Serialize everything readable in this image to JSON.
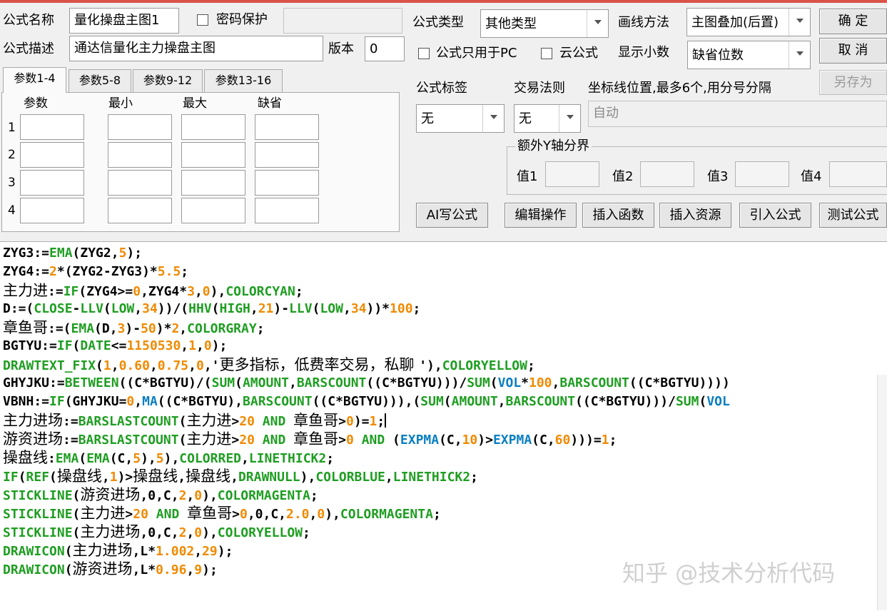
{
  "form": {
    "name_label": "公式名称",
    "name_value": "量化操盘主图1",
    "password_label": "密码保护",
    "desc_label": "公式描述",
    "desc_value": "通达信量化主力操盘主图",
    "version_label": "版本",
    "version_value": "0",
    "type_label": "公式类型",
    "type_value": "其他类型",
    "draw_label": "画线方法",
    "draw_value": "主图叠加(后置)",
    "pc_only_label": "公式只用于PC",
    "cloud_label": "云公式",
    "decimals_label": "显示小数",
    "decimals_value": "缺省位数",
    "tag_label": "公式标签",
    "tag_value": "无",
    "trade_label": "交易法则",
    "trade_value": "无",
    "axis_label": "坐标线位置,最多6个,用分号分隔",
    "axis_value": "自动",
    "extra_y_label": "额外Y轴分界",
    "y_values": [
      "值1",
      "值2",
      "值3",
      "值4"
    ]
  },
  "buttons": {
    "ok": "确  定",
    "cancel": "取  消",
    "save_as": "另存为",
    "ai": "AI写公式",
    "edit": "编辑操作",
    "insert_func": "插入函数",
    "insert_res": "插入资源",
    "import": "引入公式",
    "test": "测试公式"
  },
  "tabs": [
    "参数1-4",
    "参数5-8",
    "参数9-12",
    "参数13-16"
  ],
  "params": {
    "headers": [
      "参数",
      "最小",
      "最大",
      "缺省"
    ],
    "rows": [
      "1",
      "2",
      "3",
      "4"
    ]
  },
  "colors": {
    "keyword_green": "#1f9e22",
    "function_blue": "#0a7fc2",
    "number_orange": "#f08a00",
    "text_black": "#000000",
    "title_red": "#d9534a"
  },
  "code": [
    [
      {
        "t": "ZYG3:=",
        "c": "k"
      },
      {
        "t": "EMA",
        "c": "g"
      },
      {
        "t": "(ZYG2,",
        "c": "k"
      },
      {
        "t": "5",
        "c": "o"
      },
      {
        "t": ");",
        "c": "k"
      }
    ],
    [
      {
        "t": "ZYG4:=",
        "c": "k"
      },
      {
        "t": "2",
        "c": "o"
      },
      {
        "t": "*(ZYG2-ZYG3)*",
        "c": "k"
      },
      {
        "t": "5.5",
        "c": "o"
      },
      {
        "t": ";",
        "c": "k"
      }
    ],
    [
      {
        "t": "主力进",
        "c": "kc"
      },
      {
        "t": ":=",
        "c": "k"
      },
      {
        "t": "IF",
        "c": "g"
      },
      {
        "t": "(ZYG4>=",
        "c": "k"
      },
      {
        "t": "0",
        "c": "o"
      },
      {
        "t": ",ZYG4*",
        "c": "k"
      },
      {
        "t": "3",
        "c": "o"
      },
      {
        "t": ",",
        "c": "k"
      },
      {
        "t": "0",
        "c": "o"
      },
      {
        "t": "),",
        "c": "k"
      },
      {
        "t": "COLORCYAN",
        "c": "g"
      },
      {
        "t": ";",
        "c": "k"
      }
    ],
    [
      {
        "t": "D:=(",
        "c": "k"
      },
      {
        "t": "CLOSE",
        "c": "g"
      },
      {
        "t": "-",
        "c": "k"
      },
      {
        "t": "LLV",
        "c": "g"
      },
      {
        "t": "(",
        "c": "k"
      },
      {
        "t": "LOW",
        "c": "g"
      },
      {
        "t": ",",
        "c": "k"
      },
      {
        "t": "34",
        "c": "o"
      },
      {
        "t": "))/(",
        "c": "k"
      },
      {
        "t": "HHV",
        "c": "g"
      },
      {
        "t": "(",
        "c": "k"
      },
      {
        "t": "HIGH",
        "c": "g"
      },
      {
        "t": ",",
        "c": "k"
      },
      {
        "t": "21",
        "c": "o"
      },
      {
        "t": ")-",
        "c": "k"
      },
      {
        "t": "LLV",
        "c": "g"
      },
      {
        "t": "(",
        "c": "k"
      },
      {
        "t": "LOW",
        "c": "g"
      },
      {
        "t": ",",
        "c": "k"
      },
      {
        "t": "34",
        "c": "o"
      },
      {
        "t": "))*",
        "c": "k"
      },
      {
        "t": "100",
        "c": "o"
      },
      {
        "t": ";",
        "c": "k"
      }
    ],
    [
      {
        "t": "章鱼哥",
        "c": "kc"
      },
      {
        "t": ":=(",
        "c": "k"
      },
      {
        "t": "EMA",
        "c": "g"
      },
      {
        "t": "(D,",
        "c": "k"
      },
      {
        "t": "3",
        "c": "o"
      },
      {
        "t": ")-",
        "c": "k"
      },
      {
        "t": "50",
        "c": "o"
      },
      {
        "t": ")*",
        "c": "k"
      },
      {
        "t": "2",
        "c": "o"
      },
      {
        "t": ",",
        "c": "k"
      },
      {
        "t": "COLORGRAY",
        "c": "g"
      },
      {
        "t": ";",
        "c": "k"
      }
    ],
    [
      {
        "t": "BGTYU:=",
        "c": "k"
      },
      {
        "t": "IF",
        "c": "g"
      },
      {
        "t": "(",
        "c": "k"
      },
      {
        "t": "DATE",
        "c": "g"
      },
      {
        "t": "<=",
        "c": "k"
      },
      {
        "t": "1150530",
        "c": "o"
      },
      {
        "t": ",",
        "c": "k"
      },
      {
        "t": "1",
        "c": "o"
      },
      {
        "t": ",",
        "c": "k"
      },
      {
        "t": "0",
        "c": "o"
      },
      {
        "t": ");",
        "c": "k"
      }
    ],
    [
      {
        "t": "DRAWTEXT_FIX",
        "c": "g"
      },
      {
        "t": "(",
        "c": "k"
      },
      {
        "t": "1",
        "c": "o"
      },
      {
        "t": ",",
        "c": "k"
      },
      {
        "t": "0.60",
        "c": "o"
      },
      {
        "t": ",",
        "c": "k"
      },
      {
        "t": "0.75",
        "c": "o"
      },
      {
        "t": ",",
        "c": "k"
      },
      {
        "t": "0",
        "c": "o"
      },
      {
        "t": ",'",
        "c": "k"
      },
      {
        "t": "更多指标，低费率交易，私聊 ",
        "c": "kc"
      },
      {
        "t": "'),",
        "c": "k"
      },
      {
        "t": "COLORYELLOW",
        "c": "g"
      },
      {
        "t": ";",
        "c": "k"
      }
    ],
    [
      {
        "t": "GHYJKU:=",
        "c": "k"
      },
      {
        "t": "BETWEEN",
        "c": "g"
      },
      {
        "t": "((C*BGTYU)/(",
        "c": "k"
      },
      {
        "t": "SUM",
        "c": "g"
      },
      {
        "t": "(",
        "c": "k"
      },
      {
        "t": "AMOUNT",
        "c": "g"
      },
      {
        "t": ",",
        "c": "k"
      },
      {
        "t": "BARSCOUNT",
        "c": "g"
      },
      {
        "t": "((C*BGTYU)))/",
        "c": "k"
      },
      {
        "t": "SUM",
        "c": "g"
      },
      {
        "t": "(",
        "c": "k"
      },
      {
        "t": "VOL",
        "c": "b"
      },
      {
        "t": "*",
        "c": "k"
      },
      {
        "t": "100",
        "c": "o"
      },
      {
        "t": ",",
        "c": "k"
      },
      {
        "t": "BARSCOUNT",
        "c": "g"
      },
      {
        "t": "((C*BGTYU))))",
        "c": "k"
      }
    ],
    [
      {
        "t": "VBNH:=",
        "c": "k"
      },
      {
        "t": "IF",
        "c": "g"
      },
      {
        "t": "(GHYJKU=",
        "c": "k"
      },
      {
        "t": "0",
        "c": "o"
      },
      {
        "t": ",",
        "c": "k"
      },
      {
        "t": "MA",
        "c": "b"
      },
      {
        "t": "((C*BGTYU),",
        "c": "k"
      },
      {
        "t": "BARSCOUNT",
        "c": "g"
      },
      {
        "t": "((C*BGTYU))),(",
        "c": "k"
      },
      {
        "t": "SUM",
        "c": "g"
      },
      {
        "t": "(",
        "c": "k"
      },
      {
        "t": "AMOUNT",
        "c": "g"
      },
      {
        "t": ",",
        "c": "k"
      },
      {
        "t": "BARSCOUNT",
        "c": "g"
      },
      {
        "t": "((C*BGTYU)))/",
        "c": "k"
      },
      {
        "t": "SUM",
        "c": "g"
      },
      {
        "t": "(",
        "c": "k"
      },
      {
        "t": "VOL",
        "c": "b"
      }
    ],
    [
      {
        "t": "主力进场",
        "c": "kc"
      },
      {
        "t": ":=",
        "c": "k"
      },
      {
        "t": "BARSLASTCOUNT",
        "c": "g"
      },
      {
        "t": "(",
        "c": "k"
      },
      {
        "t": "主力进",
        "c": "kc"
      },
      {
        "t": ">",
        "c": "k"
      },
      {
        "t": "20",
        "c": "o"
      },
      {
        "t": " ",
        "c": "k"
      },
      {
        "t": "AND",
        "c": "g"
      },
      {
        "t": " ",
        "c": "k"
      },
      {
        "t": "章鱼哥",
        "c": "kc"
      },
      {
        "t": ">",
        "c": "k"
      },
      {
        "t": "0",
        "c": "o"
      },
      {
        "t": ")=",
        "c": "k"
      },
      {
        "t": "1",
        "c": "o"
      },
      {
        "t": ";",
        "c": "k"
      },
      {
        "t": "",
        "c": "caret"
      }
    ],
    [
      {
        "t": "游资进场",
        "c": "kc"
      },
      {
        "t": ":=",
        "c": "k"
      },
      {
        "t": "BARSLASTCOUNT",
        "c": "g"
      },
      {
        "t": "(",
        "c": "k"
      },
      {
        "t": "主力进",
        "c": "kc"
      },
      {
        "t": ">",
        "c": "k"
      },
      {
        "t": "20",
        "c": "o"
      },
      {
        "t": " ",
        "c": "k"
      },
      {
        "t": "AND",
        "c": "g"
      },
      {
        "t": " ",
        "c": "k"
      },
      {
        "t": "章鱼哥",
        "c": "kc"
      },
      {
        "t": ">",
        "c": "k"
      },
      {
        "t": "0",
        "c": "o"
      },
      {
        "t": " ",
        "c": "k"
      },
      {
        "t": "AND",
        "c": "g"
      },
      {
        "t": " (",
        "c": "k"
      },
      {
        "t": "EXPMA",
        "c": "b"
      },
      {
        "t": "(C,",
        "c": "k"
      },
      {
        "t": "10",
        "c": "o"
      },
      {
        "t": ")>",
        "c": "k"
      },
      {
        "t": "EXPMA",
        "c": "b"
      },
      {
        "t": "(C,",
        "c": "k"
      },
      {
        "t": "60",
        "c": "o"
      },
      {
        "t": ")))=",
        "c": "k"
      },
      {
        "t": "1",
        "c": "o"
      },
      {
        "t": ";",
        "c": "k"
      }
    ],
    [
      {
        "t": "操盘线",
        "c": "kc"
      },
      {
        "t": ":",
        "c": "k"
      },
      {
        "t": "EMA",
        "c": "g"
      },
      {
        "t": "(",
        "c": "k"
      },
      {
        "t": "EMA",
        "c": "g"
      },
      {
        "t": "(C,",
        "c": "k"
      },
      {
        "t": "5",
        "c": "o"
      },
      {
        "t": "),",
        "c": "k"
      },
      {
        "t": "5",
        "c": "o"
      },
      {
        "t": "),",
        "c": "k"
      },
      {
        "t": "COLORRED",
        "c": "g"
      },
      {
        "t": ",",
        "c": "k"
      },
      {
        "t": "LINETHICK2",
        "c": "g"
      },
      {
        "t": ";",
        "c": "k"
      }
    ],
    [
      {
        "t": "IF",
        "c": "g"
      },
      {
        "t": "(",
        "c": "k"
      },
      {
        "t": "REF",
        "c": "g"
      },
      {
        "t": "(",
        "c": "k"
      },
      {
        "t": "操盘线",
        "c": "kc"
      },
      {
        "t": ",",
        "c": "k"
      },
      {
        "t": "1",
        "c": "o"
      },
      {
        "t": ")>",
        "c": "k"
      },
      {
        "t": "操盘线",
        "c": "kc"
      },
      {
        "t": ",",
        "c": "k"
      },
      {
        "t": "操盘线",
        "c": "kc"
      },
      {
        "t": ",",
        "c": "k"
      },
      {
        "t": "DRAWNULL",
        "c": "g"
      },
      {
        "t": "),",
        "c": "k"
      },
      {
        "t": "COLORBLUE",
        "c": "g"
      },
      {
        "t": ",",
        "c": "k"
      },
      {
        "t": "LINETHICK2",
        "c": "g"
      },
      {
        "t": ";",
        "c": "k"
      }
    ],
    [
      {
        "t": "STICKLINE",
        "c": "g"
      },
      {
        "t": "(",
        "c": "k"
      },
      {
        "t": "游资进场",
        "c": "kc"
      },
      {
        "t": ",0,C,",
        "c": "k"
      },
      {
        "t": "2",
        "c": "o"
      },
      {
        "t": ",",
        "c": "k"
      },
      {
        "t": "0",
        "c": "o"
      },
      {
        "t": "),",
        "c": "k"
      },
      {
        "t": "COLORMAGENTA",
        "c": "g"
      },
      {
        "t": ";",
        "c": "k"
      }
    ],
    [
      {
        "t": "STICKLINE",
        "c": "g"
      },
      {
        "t": "(",
        "c": "k"
      },
      {
        "t": "主力进",
        "c": "kc"
      },
      {
        "t": ">",
        "c": "k"
      },
      {
        "t": "20",
        "c": "o"
      },
      {
        "t": " ",
        "c": "k"
      },
      {
        "t": "AND",
        "c": "g"
      },
      {
        "t": " ",
        "c": "k"
      },
      {
        "t": "章鱼哥",
        "c": "kc"
      },
      {
        "t": ">",
        "c": "k"
      },
      {
        "t": "0",
        "c": "o"
      },
      {
        "t": ",0,C,",
        "c": "k"
      },
      {
        "t": "2.0",
        "c": "o"
      },
      {
        "t": ",",
        "c": "k"
      },
      {
        "t": "0",
        "c": "o"
      },
      {
        "t": "),",
        "c": "k"
      },
      {
        "t": "COLORMAGENTA",
        "c": "g"
      },
      {
        "t": ";",
        "c": "k"
      }
    ],
    [
      {
        "t": "STICKLINE",
        "c": "g"
      },
      {
        "t": "(",
        "c": "k"
      },
      {
        "t": "主力进场",
        "c": "kc"
      },
      {
        "t": ",0,C,",
        "c": "k"
      },
      {
        "t": "2",
        "c": "o"
      },
      {
        "t": ",",
        "c": "k"
      },
      {
        "t": "0",
        "c": "o"
      },
      {
        "t": "),",
        "c": "k"
      },
      {
        "t": "COLORYELLOW",
        "c": "g"
      },
      {
        "t": ";",
        "c": "k"
      }
    ],
    [
      {
        "t": "DRAWICON",
        "c": "g"
      },
      {
        "t": "(",
        "c": "k"
      },
      {
        "t": "主力进场",
        "c": "kc"
      },
      {
        "t": ",L*",
        "c": "k"
      },
      {
        "t": "1.002",
        "c": "o"
      },
      {
        "t": ",",
        "c": "k"
      },
      {
        "t": "29",
        "c": "o"
      },
      {
        "t": ");",
        "c": "k"
      }
    ],
    [
      {
        "t": "DRAWICON",
        "c": "g"
      },
      {
        "t": "(",
        "c": "k"
      },
      {
        "t": "游资进场",
        "c": "kc"
      },
      {
        "t": ",L*",
        "c": "k"
      },
      {
        "t": "0.96",
        "c": "o"
      },
      {
        "t": ",",
        "c": "k"
      },
      {
        "t": "9",
        "c": "o"
      },
      {
        "t": ");",
        "c": "k"
      }
    ]
  ],
  "watermark": "知乎 @技术分析代码"
}
